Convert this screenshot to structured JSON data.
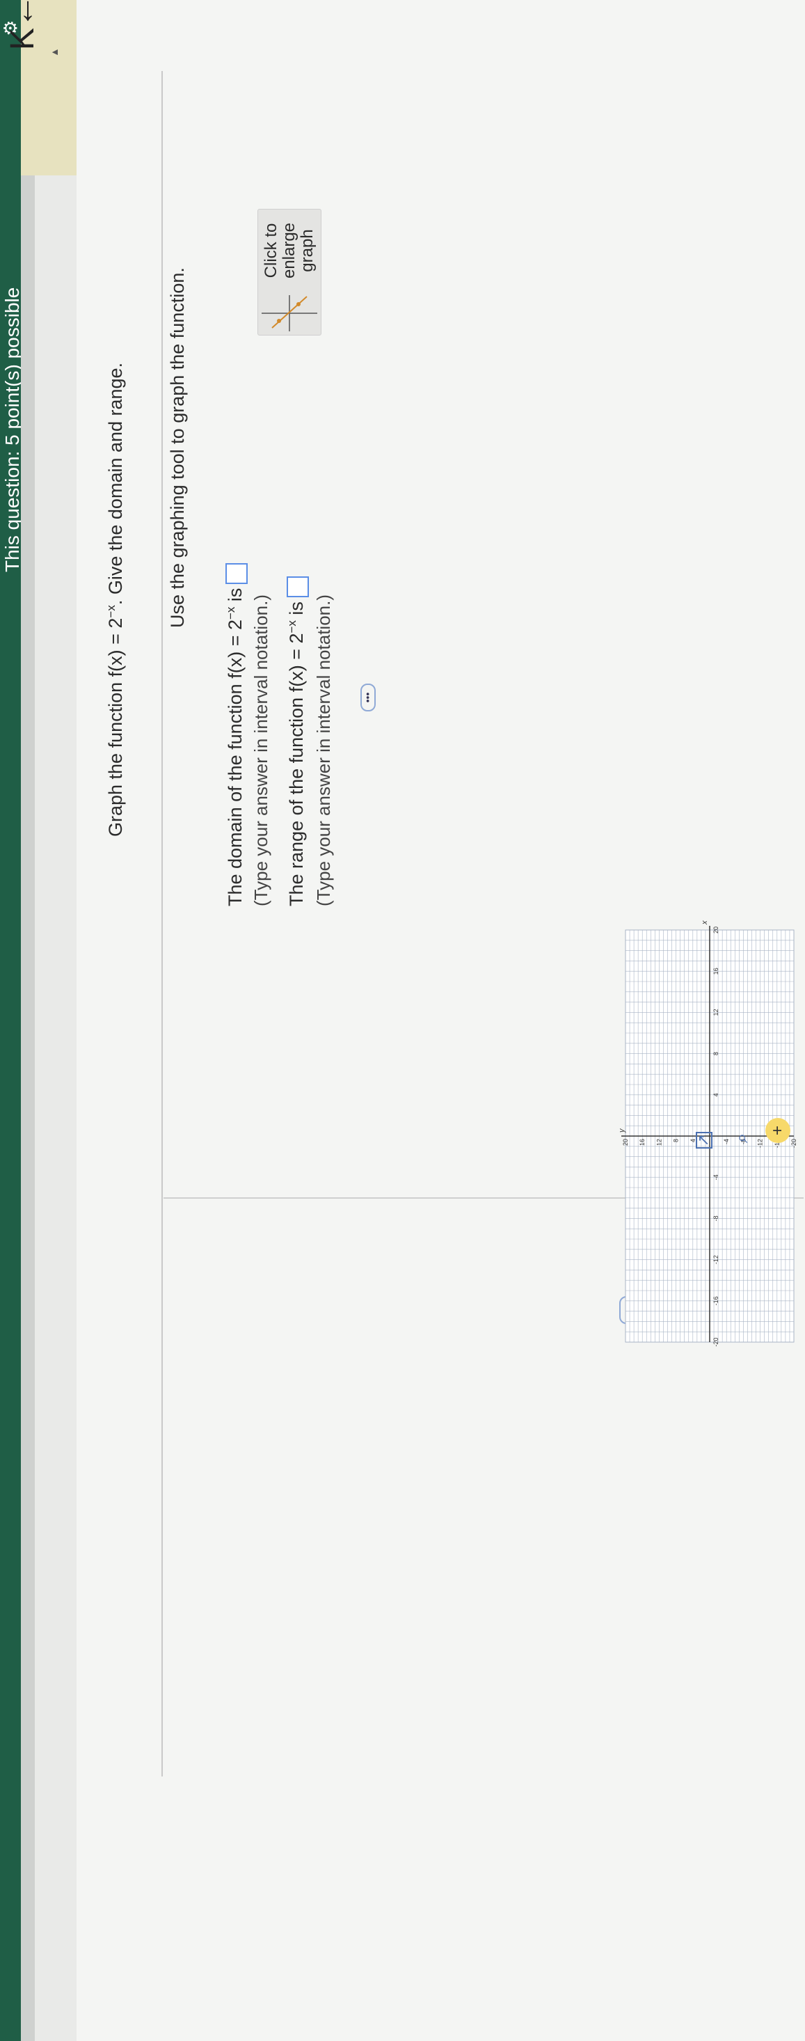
{
  "header": {
    "points": "This question: 5 point(s) possible"
  },
  "nav": {
    "back_icon": "back-to-start-icon"
  },
  "question": {
    "prefix": "Graph the function f(x) = 2",
    "exp": "−x",
    "suffix": ". Give the domain and range."
  },
  "left": {
    "instruction": "Use the graphing tool to graph the function.",
    "enlarge": {
      "line1": "Click to",
      "line2": "enlarge",
      "line3": "graph"
    },
    "domain": {
      "prefix": "The domain of the function f(x) = 2",
      "exp": "−x",
      "suffix": " is",
      "hint": "(Type your answer in interval notation.)"
    },
    "range": {
      "prefix": "The range of the function f(x) = 2",
      "exp": "−x",
      "suffix": " is",
      "hint": "(Type your answer in interval notation.)"
    }
  },
  "ellipsis": "•••",
  "graph": {
    "x_label": "x",
    "y_label": "y",
    "x_ticks": [
      "-20",
      "-16",
      "-12",
      "-8",
      "-4",
      "4",
      "8",
      "12",
      "16",
      "20"
    ],
    "y_ticks": [
      "20",
      "16",
      "12",
      "8",
      "4",
      "-4",
      "-8",
      "-12",
      "-16",
      "-20"
    ],
    "x_range": [
      -20,
      20
    ],
    "y_range": [
      -20,
      20
    ]
  },
  "colors": {
    "header": "#1f5e46",
    "accent": "#5b8ee6",
    "axis": "#333333",
    "grid": "#a9b4c6"
  }
}
